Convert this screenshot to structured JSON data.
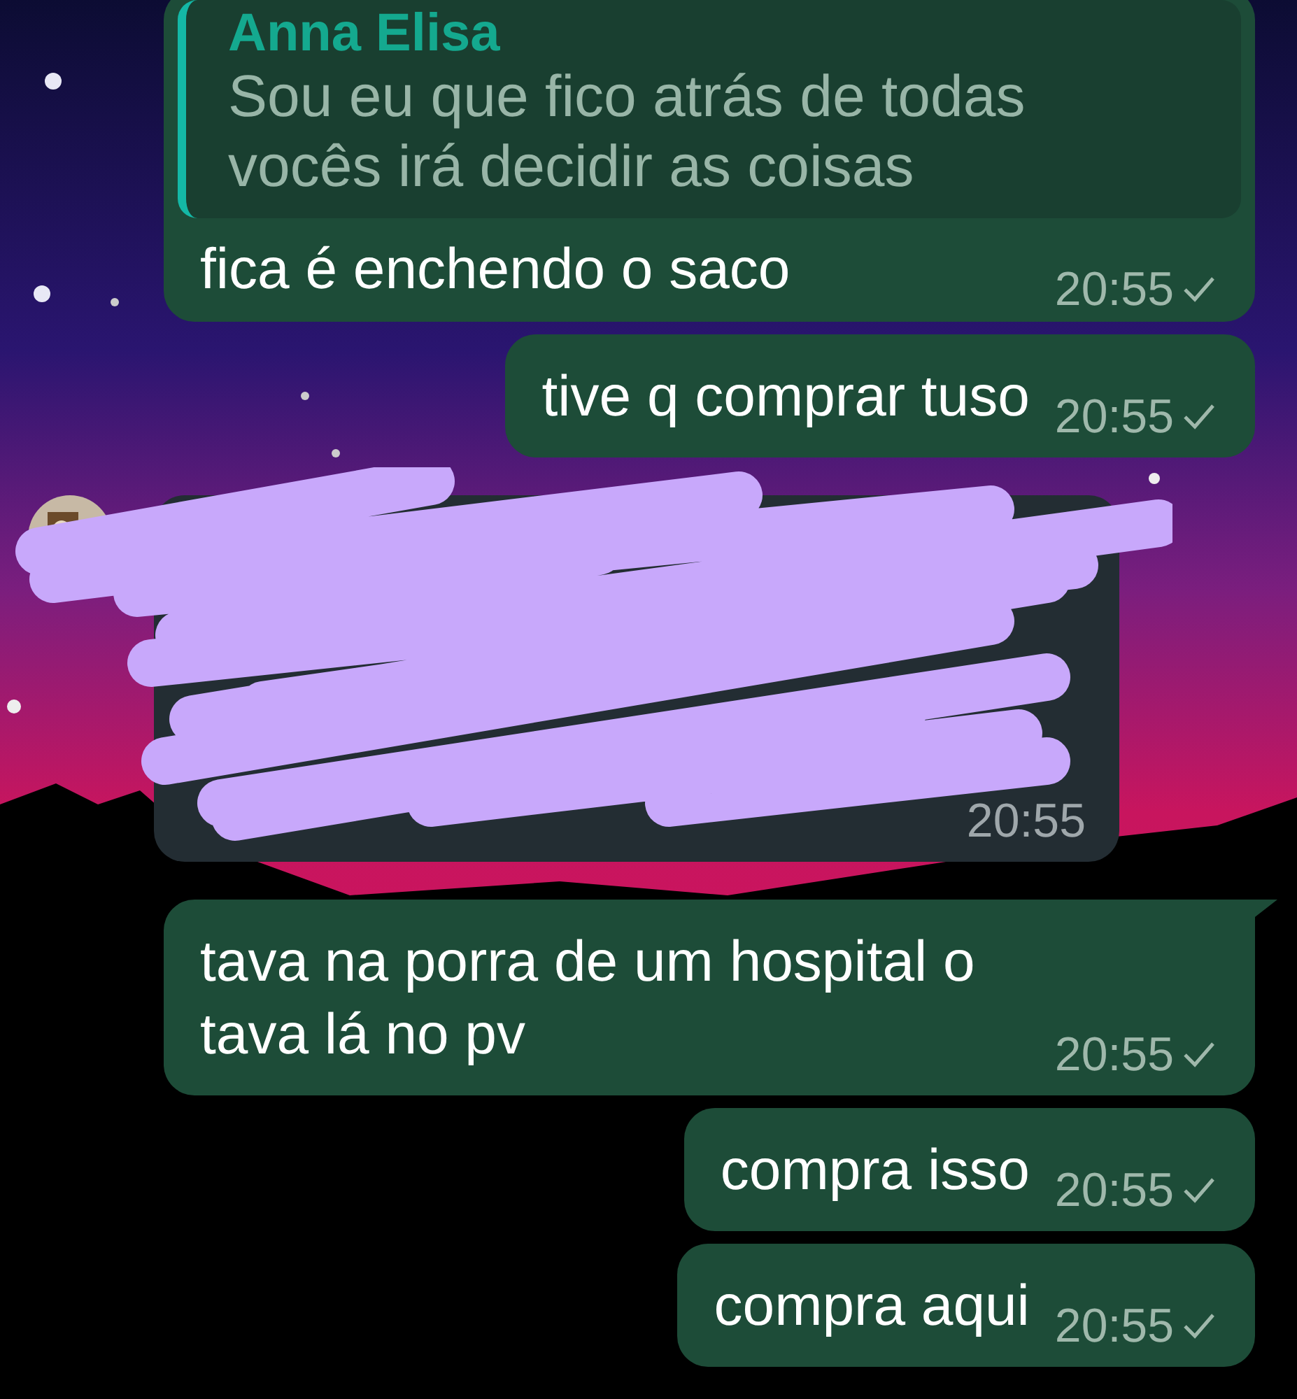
{
  "messages": [
    {
      "kind": "sent",
      "quote": {
        "author": "Anna Elisa",
        "text": "Sou eu que fico atrás de todas vocês irá decidir as coisas"
      },
      "text": "fica é enchendo o saco",
      "time": "20:55",
      "tail": false
    },
    {
      "kind": "sent",
      "text": "tive q comprar tuso",
      "time": "20:55",
      "tail": false
    },
    {
      "kind": "received",
      "redacted": true,
      "time": "20:55"
    },
    {
      "kind": "sent",
      "text": "tava na porra de um hospital o tava lá no pv",
      "time": "20:55",
      "tail": true
    },
    {
      "kind": "sent",
      "text": "compra isso",
      "time": "20:55",
      "tail": false
    },
    {
      "kind": "sent",
      "text": "compra aqui",
      "time": "20:55",
      "tail": false
    }
  ]
}
